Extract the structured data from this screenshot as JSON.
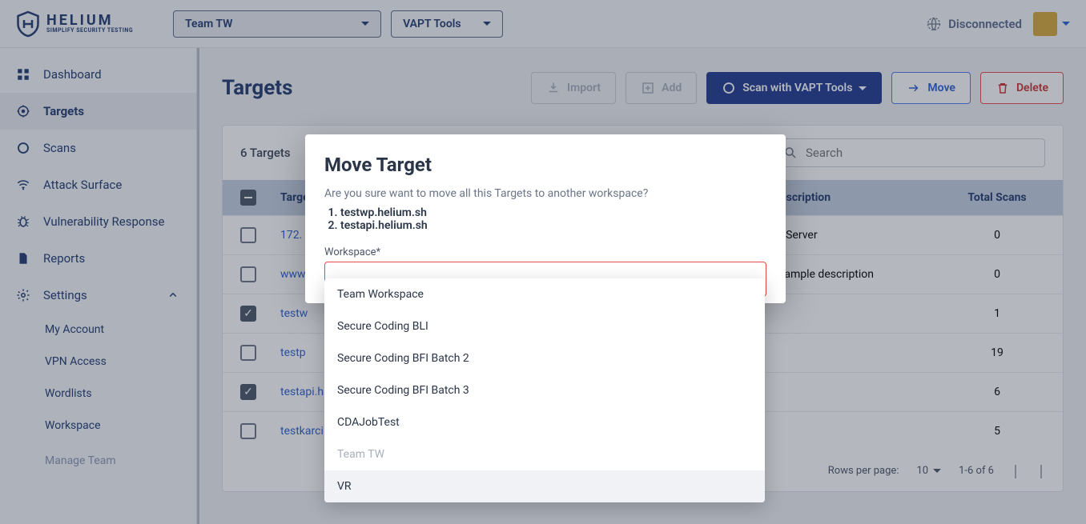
{
  "header": {
    "brand_title": "HELIUM",
    "brand_sub": "SIMPLIFY SECURITY TESTING",
    "team_selector": "Team TW",
    "tools_selector": "VAPT Tools",
    "connection_status": "Disconnected"
  },
  "sidebar": {
    "items": [
      {
        "label": "Dashboard"
      },
      {
        "label": "Targets"
      },
      {
        "label": "Scans"
      },
      {
        "label": "Attack Surface"
      },
      {
        "label": "Vulnerability Response"
      },
      {
        "label": "Reports"
      },
      {
        "label": "Settings"
      }
    ],
    "settings_sub": [
      {
        "label": "My Account"
      },
      {
        "label": "VPN Access"
      },
      {
        "label": "Wordlists"
      },
      {
        "label": "Workspace"
      },
      {
        "label": "Manage Team"
      }
    ]
  },
  "page": {
    "title": "Targets",
    "actions": {
      "import": "Import",
      "add": "Add",
      "scan": "Scan with VAPT Tools",
      "move": "Move",
      "delete": "Delete"
    }
  },
  "table": {
    "count_label": "6 Targets",
    "search_placeholder": "Search",
    "columns": {
      "target": "Target",
      "description": "Description",
      "total_scans": "Total Scans"
    },
    "rows": [
      {
        "target": "172.",
        "description": "IP Server",
        "scans": "0",
        "checked": false
      },
      {
        "target": "www",
        "description": "example description",
        "scans": "0",
        "checked": false
      },
      {
        "target": "testw",
        "description": "",
        "scans": "1",
        "checked": true
      },
      {
        "target": "testp",
        "description": "",
        "scans": "19",
        "checked": false
      },
      {
        "target": "testapi.h",
        "description": "",
        "scans": "6",
        "checked": true
      },
      {
        "target": "testkarci",
        "description": "",
        "scans": "5",
        "checked": false
      }
    ],
    "footer": {
      "rows_per_page_label": "Rows per page:",
      "rows_per_page_value": "10",
      "range": "1-6 of 6"
    }
  },
  "modal": {
    "title": "Move Target",
    "confirm_text": "Are you sure want to move all this Targets to another workspace?",
    "items": [
      "testwp.helium.sh",
      "testapi.helium.sh"
    ],
    "field_label": "Workspace*"
  },
  "workspace_dropdown": [
    {
      "label": "Team Workspace",
      "disabled": false
    },
    {
      "label": "Secure Coding BLI",
      "disabled": false
    },
    {
      "label": "Secure Coding BFI Batch 2",
      "disabled": false
    },
    {
      "label": "Secure Coding BFI Batch 3",
      "disabled": false
    },
    {
      "label": "CDAJobTest",
      "disabled": false
    },
    {
      "label": "Team TW",
      "disabled": true
    },
    {
      "label": "VR",
      "disabled": false,
      "hovered": true
    }
  ]
}
